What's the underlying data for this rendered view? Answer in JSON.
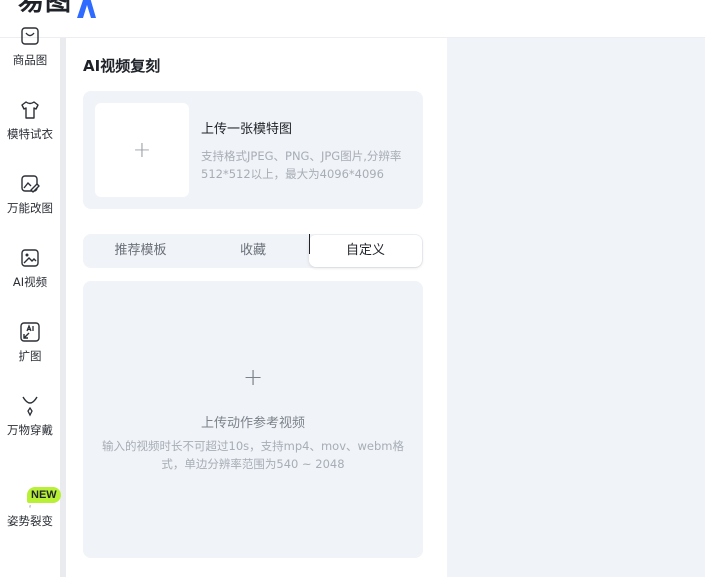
{
  "brand": {
    "name": "易图",
    "mark": "AI"
  },
  "nav": {
    "items": [
      {
        "label": "商品图",
        "icon": "bag-icon"
      },
      {
        "label": "模特试衣",
        "icon": "shirt-icon"
      },
      {
        "label": "万能改图",
        "icon": "image-edit-icon"
      },
      {
        "label": "AI视频",
        "icon": "video-icon"
      },
      {
        "label": "扩图",
        "icon": "expand-ai-icon"
      },
      {
        "label": "万物穿戴",
        "icon": "necklace-icon"
      },
      {
        "label": "姿势裂变",
        "icon": "pose-icon"
      }
    ],
    "new_badge": "NEW"
  },
  "panel": {
    "title": "AI视频复刻",
    "upload_image": {
      "title": "上传一张模特图",
      "hint": "支持格式JPEG、PNG、JPG图片,分辨率512*512以上，最大为4096*4096"
    },
    "tabs": [
      {
        "label": "推荐模板",
        "active": false
      },
      {
        "label": "收藏",
        "active": false
      },
      {
        "label": "自定义",
        "active": true
      }
    ],
    "upload_video": {
      "title": "上传动作参考视频",
      "hint": "输入的视频时长不可超过10s，支持mp4、mov、webm格式，单边分辨率范围为540 ~ 2048"
    }
  },
  "colors": {
    "panel_bg": "#f0f3f7",
    "new_badge": "#b7f035",
    "text_primary": "#1f2329",
    "text_hint": "#a7adb6"
  }
}
